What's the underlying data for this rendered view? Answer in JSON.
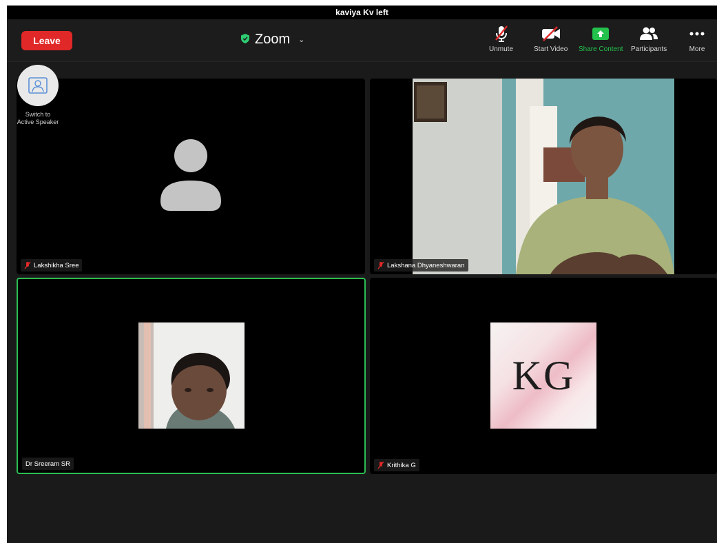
{
  "notification": {
    "text": "kaviya Kv left"
  },
  "toolbar": {
    "leave_label": "Leave",
    "meeting_name": "Zoom",
    "buttons": {
      "unmute": "Unmute",
      "start_video": "Start Video",
      "share_content": "Share Content",
      "participants": "Participants",
      "more": "More"
    }
  },
  "view_switch": {
    "line1": "Switch to",
    "line2": "Active Speaker"
  },
  "participants": [
    {
      "name": "Lakshikha Sree",
      "muted": true,
      "video": false
    },
    {
      "name": "Lakshana Dhyaneshwaran",
      "muted": true,
      "video": true
    },
    {
      "name": "Dr Sreeram SR",
      "muted": false,
      "video": false,
      "active_speaker": true
    },
    {
      "name": "Krithika G",
      "muted": true,
      "video": false
    }
  ],
  "krithika_avatar": {
    "initials": "KG"
  },
  "colors": {
    "leave": "#e02828",
    "active_border": "#2cbe52",
    "share": "#24c14c",
    "shield": "#2ecc71"
  }
}
